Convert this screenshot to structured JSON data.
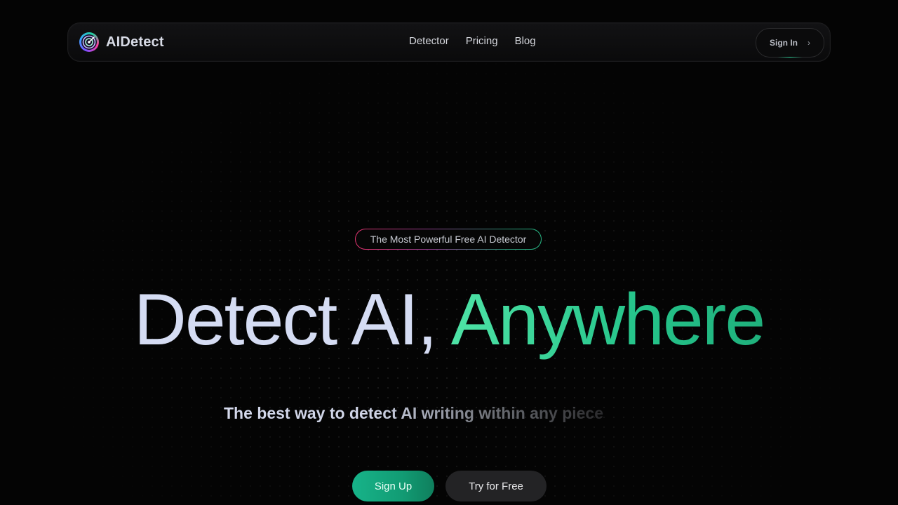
{
  "nav": {
    "brand": "AIDetect",
    "links": [
      "Detector",
      "Pricing",
      "Blog"
    ],
    "signin_label": "Sign In",
    "signin_chevron": "›"
  },
  "hero": {
    "badge": "The Most Powerful Free AI Detector",
    "title_part1": "Detect AI, ",
    "title_part2": "Anywhere",
    "subtitle": "The best way to detect AI writing within any piece"
  },
  "actions": {
    "signup_label": "Sign Up",
    "try_label": "Try for Free"
  },
  "colors": {
    "accent_green": "#25c48a",
    "background": "#040404",
    "title_text": "#d5dcf3"
  },
  "icons": {
    "logo": "radar-target-icon",
    "signin_chevron": "chevron-right-icon"
  }
}
